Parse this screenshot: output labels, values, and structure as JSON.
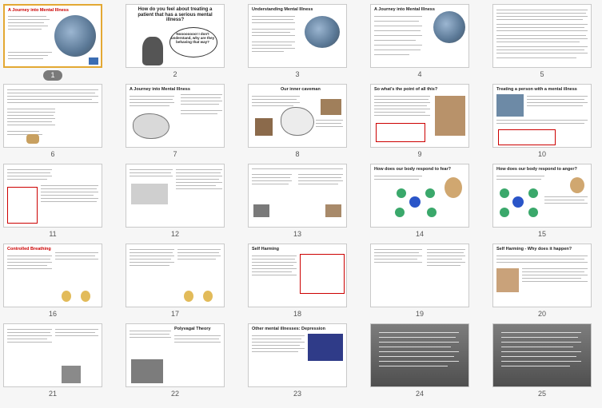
{
  "slides": [
    {
      "n": "1",
      "title": "A Journey into Mental Illness"
    },
    {
      "n": "2",
      "title": "How do you feel about treating a patient that has a serious mental illness?",
      "bubble": "Noooooooo! I don't understand, why are they behaving that way?"
    },
    {
      "n": "3",
      "title": "Understanding Mental Illness"
    },
    {
      "n": "4",
      "title": "A Journey into Mental Illness"
    },
    {
      "n": "5",
      "title": ""
    },
    {
      "n": "6",
      "title": ""
    },
    {
      "n": "7",
      "title": "A Journey into Mental Illness"
    },
    {
      "n": "8",
      "title": "Our inner caveman"
    },
    {
      "n": "9",
      "title": "So what's the point of all this?"
    },
    {
      "n": "10",
      "title": "Treating a person with a mental illness"
    },
    {
      "n": "11",
      "title": ""
    },
    {
      "n": "12",
      "title": ""
    },
    {
      "n": "13",
      "title": ""
    },
    {
      "n": "14",
      "title": "How does our body respond to fear?"
    },
    {
      "n": "15",
      "title": "How does our body respond to anger?"
    },
    {
      "n": "16",
      "title": "Controlled Breathing"
    },
    {
      "n": "17",
      "title": ""
    },
    {
      "n": "18",
      "title": "Self Harming"
    },
    {
      "n": "19",
      "title": ""
    },
    {
      "n": "20",
      "title": "Self Harming - Why does it happen?"
    },
    {
      "n": "21",
      "title": ""
    },
    {
      "n": "22",
      "title": "Polyvagal Theory"
    },
    {
      "n": "23",
      "title": "Other mental illnesses: Depression"
    },
    {
      "n": "24",
      "title": ""
    },
    {
      "n": "25",
      "title": ""
    }
  ]
}
